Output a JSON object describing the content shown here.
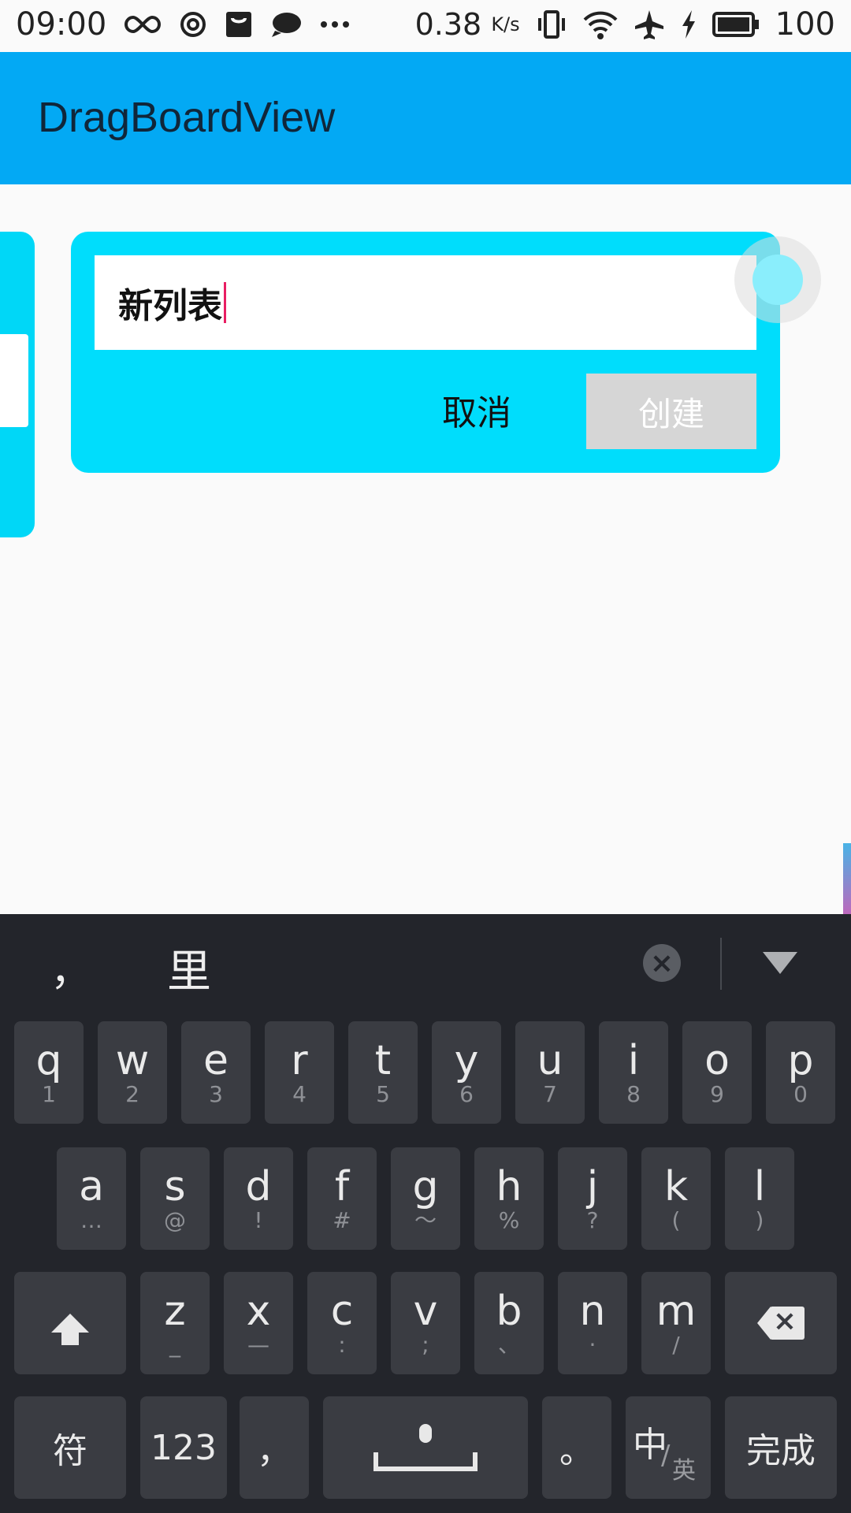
{
  "status_bar": {
    "time": "09:00",
    "left_icons": [
      "infinity-icon",
      "swirl-icon",
      "bag-icon",
      "chat-icon",
      "more-icon"
    ],
    "speed": "0.38",
    "speed_unit": "K/s",
    "battery": "100",
    "right_icons": [
      "vibrate-icon",
      "wifi-icon",
      "airplane-icon",
      "charging-icon",
      "battery-icon"
    ]
  },
  "app_bar": {
    "title": "DragBoardView"
  },
  "new_list_card": {
    "input_value": "新列表",
    "cancel_label": "取消",
    "create_label": "创建"
  },
  "colors": {
    "app_bar": "#03a9f4",
    "card": "#00ddfc",
    "keyboard": "#23252b",
    "key": "#3a3c42",
    "caret": "#e91e63"
  },
  "keyboard": {
    "suggestions": {
      "punct": "，",
      "candidate": "里"
    },
    "row1": [
      {
        "k": "q",
        "s": "1"
      },
      {
        "k": "w",
        "s": "2"
      },
      {
        "k": "e",
        "s": "3"
      },
      {
        "k": "r",
        "s": "4"
      },
      {
        "k": "t",
        "s": "5"
      },
      {
        "k": "y",
        "s": "6"
      },
      {
        "k": "u",
        "s": "7"
      },
      {
        "k": "i",
        "s": "8"
      },
      {
        "k": "o",
        "s": "9"
      },
      {
        "k": "p",
        "s": "0"
      }
    ],
    "row2": [
      {
        "k": "a",
        "s": "…"
      },
      {
        "k": "s",
        "s": "@"
      },
      {
        "k": "d",
        "s": "!"
      },
      {
        "k": "f",
        "s": "#"
      },
      {
        "k": "g",
        "s": "～"
      },
      {
        "k": "h",
        "s": "%"
      },
      {
        "k": "j",
        "s": "?"
      },
      {
        "k": "k",
        "s": "("
      },
      {
        "k": "l",
        "s": ")"
      }
    ],
    "row3": [
      {
        "k": "z",
        "s": "_"
      },
      {
        "k": "x",
        "s": "—"
      },
      {
        "k": "c",
        "s": ":"
      },
      {
        "k": "v",
        "s": ";"
      },
      {
        "k": "b",
        "s": "、"
      },
      {
        "k": "n",
        "s": "·"
      },
      {
        "k": "m",
        "s": "/"
      }
    ],
    "bottom": {
      "symbols": "符",
      "numbers": "123",
      "comma": "，",
      "period": "。",
      "lang_zh": "中",
      "lang_slash": "/",
      "lang_en": "英",
      "done": "完成"
    }
  }
}
